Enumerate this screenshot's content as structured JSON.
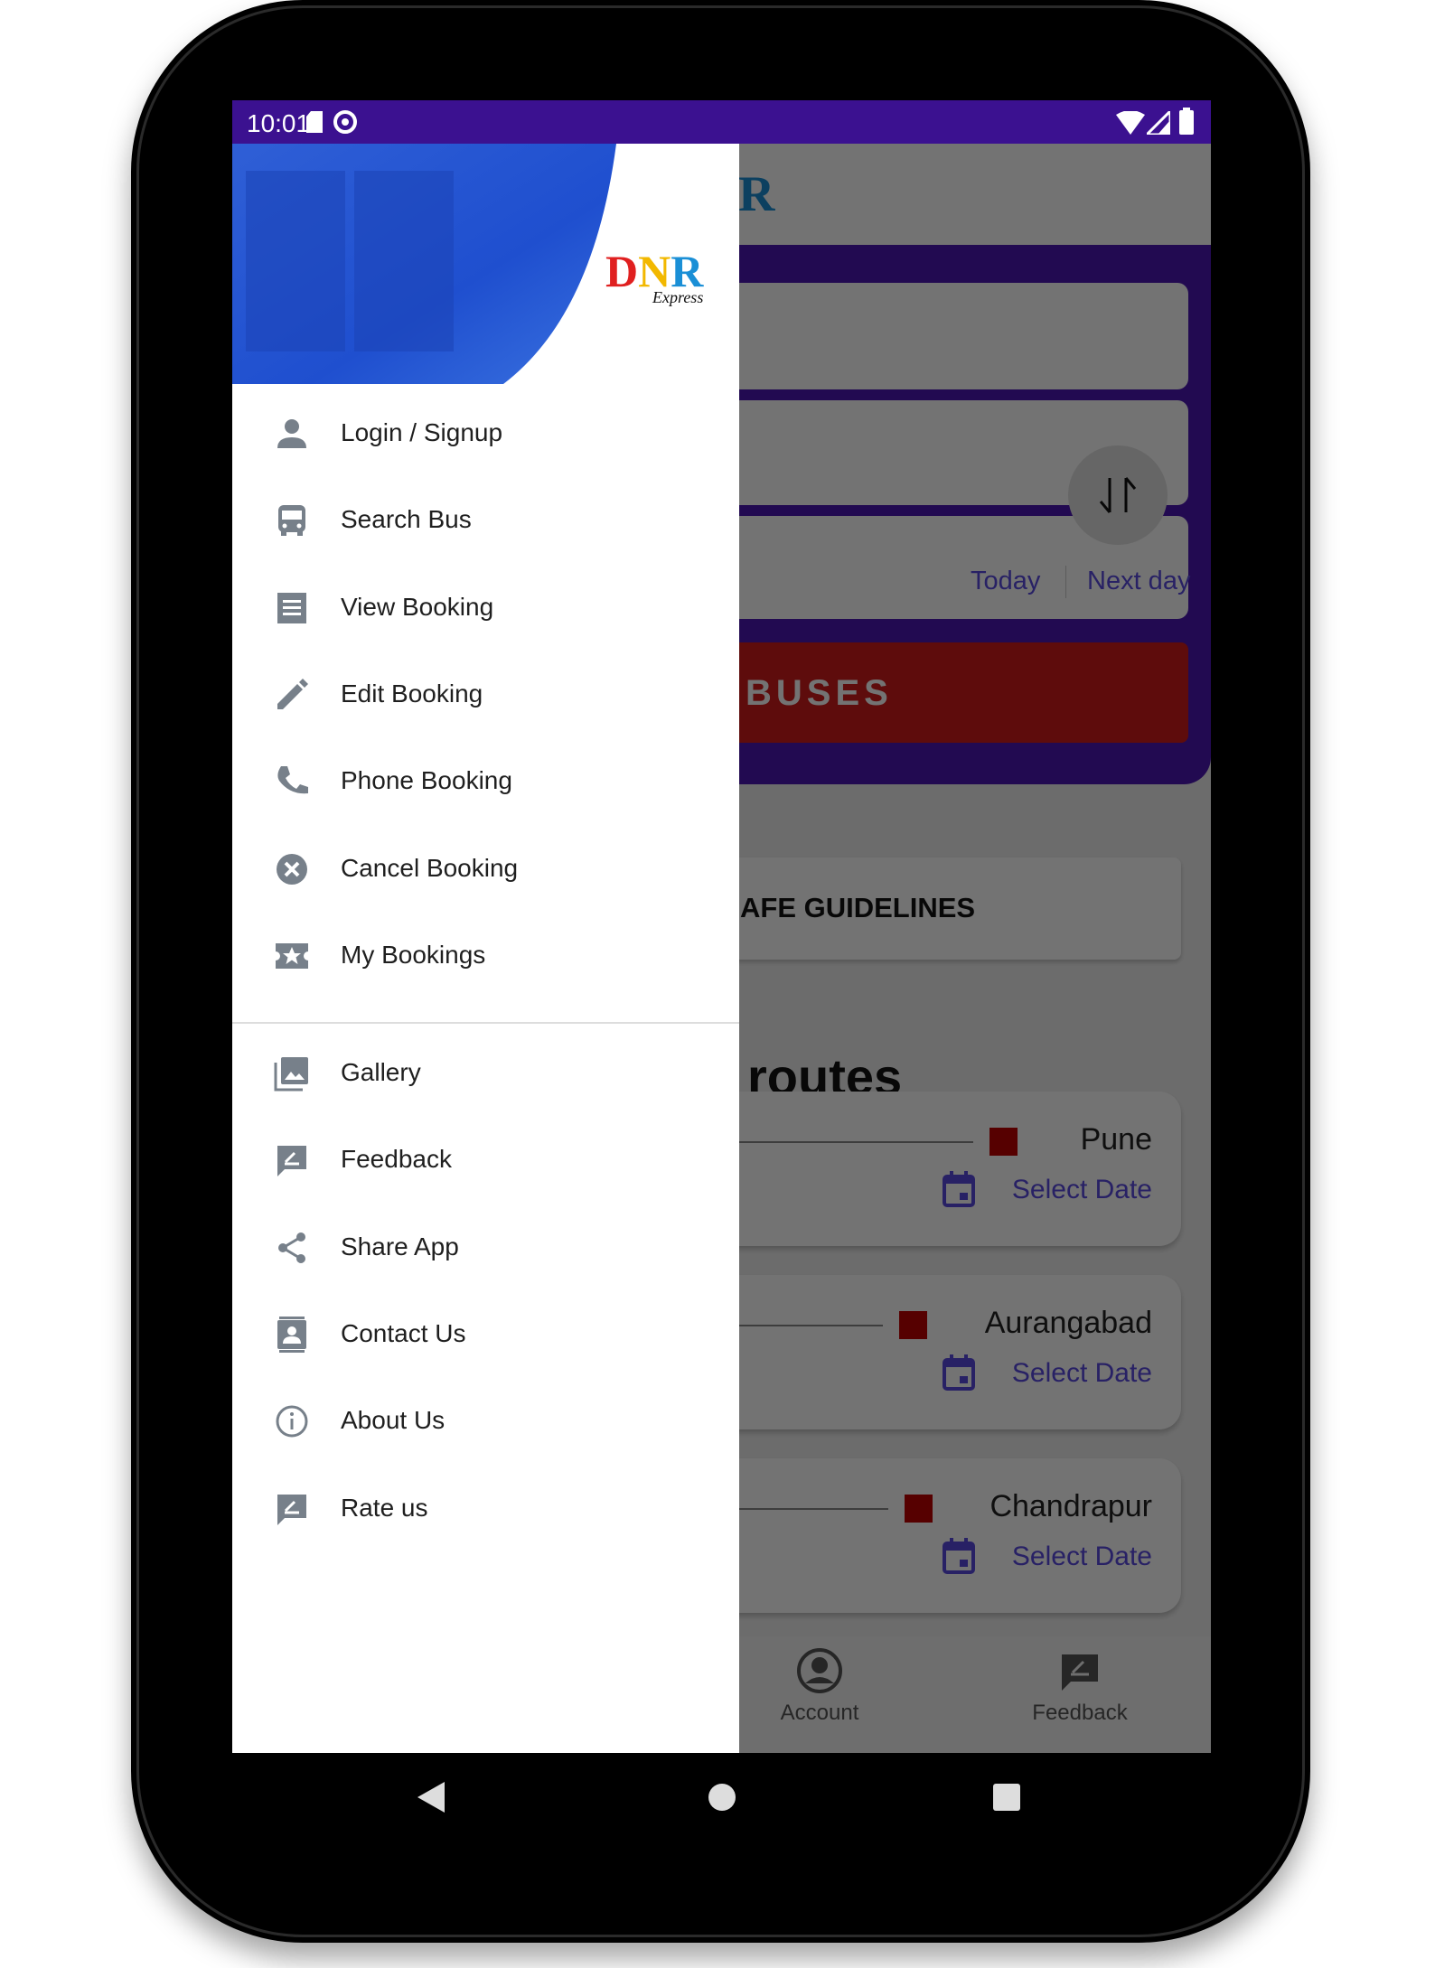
{
  "status_bar": {
    "time": "10:01",
    "icons": [
      "sd-card-icon",
      "sync-icon",
      "wifi-icon",
      "signal-icon",
      "battery-icon"
    ]
  },
  "brand": {
    "logo_text": "DNR",
    "logo_sub": "Express",
    "colors": {
      "D": "#e02020",
      "N": "#f2b800",
      "R": "#1a8fd6"
    }
  },
  "drawer": {
    "section1": [
      {
        "label": "Login / Signup",
        "icon": "person-icon"
      },
      {
        "label": "Search Bus",
        "icon": "bus-icon"
      },
      {
        "label": "View Booking",
        "icon": "receipt-icon"
      },
      {
        "label": "Edit Booking",
        "icon": "pencil-icon"
      },
      {
        "label": "Phone Booking",
        "icon": "phone-icon"
      },
      {
        "label": "Cancel Booking",
        "icon": "cancel-icon"
      },
      {
        "label": "My Bookings",
        "icon": "ticket-star-icon"
      }
    ],
    "section2": [
      {
        "label": "Gallery",
        "icon": "image-icon"
      },
      {
        "label": "Feedback",
        "icon": "feedback-icon"
      },
      {
        "label": "Share App",
        "icon": "share-icon"
      },
      {
        "label": "Contact Us",
        "icon": "contact-icon"
      },
      {
        "label": "About Us",
        "icon": "info-icon"
      },
      {
        "label": "Rate us",
        "icon": "rate-icon"
      }
    ]
  },
  "main": {
    "date_today": "Today",
    "date_next": "Next day",
    "search_button": "BUSES",
    "guidelines": "AFE GUIDELINES",
    "routes_heading": "routes",
    "routes": [
      {
        "to": "Pune",
        "action": "Select Date"
      },
      {
        "to": "Aurangabad",
        "action": "Select Date"
      },
      {
        "to": "Chandrapur",
        "action": "Select Date"
      }
    ],
    "bottom_nav": [
      {
        "label": "Account",
        "icon": "account-circle-icon"
      },
      {
        "label": "Feedback",
        "icon": "feedback-icon"
      }
    ]
  },
  "colors": {
    "status_bar": "#3b1190",
    "accent": "#3b2bb0",
    "search_button": "#d21b1b",
    "route_marker": "#c00000",
    "icon_gray": "#77808a"
  }
}
